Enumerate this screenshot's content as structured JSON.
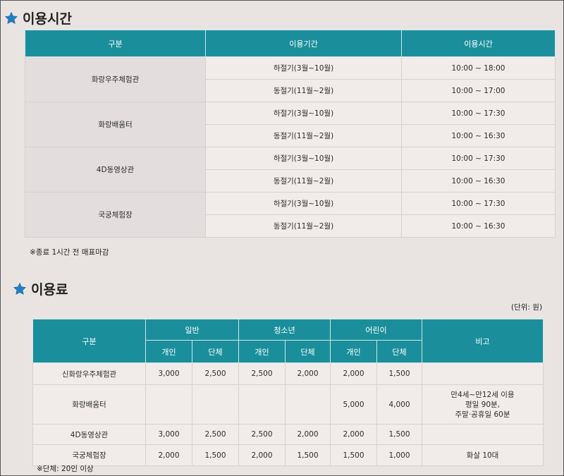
{
  "hours_section": {
    "title": "이용시간",
    "headers": [
      "구분",
      "이용기간",
      "이용시간"
    ],
    "rows": [
      {
        "facility": "화랑우주체험관",
        "periods": [
          {
            "period": "하절기(3월~10월)",
            "time": "10:00 ~ 18:00"
          },
          {
            "period": "동절기(11월~2월)",
            "time": "10:00 ~ 17:00"
          }
        ]
      },
      {
        "facility": "화랑배움터",
        "periods": [
          {
            "period": "하절기(3월~10월)",
            "time": "10:00 ~ 17:30"
          },
          {
            "period": "동절기(11월~2월)",
            "time": "10:00 ~ 16:30"
          }
        ]
      },
      {
        "facility": "4D동영상관",
        "periods": [
          {
            "period": "하절기(3월~10월)",
            "time": "10:00 ~ 17:30"
          },
          {
            "period": "동절기(11월~2월)",
            "time": "10:00 ~ 16:30"
          }
        ]
      },
      {
        "facility": "국궁체험장",
        "periods": [
          {
            "period": "하절기(3월~10월)",
            "time": "10:00 ~ 17:30"
          },
          {
            "period": "동절기(11월~2월)",
            "time": "10:00 ~ 16:30"
          }
        ]
      }
    ],
    "note": "※종료 1시간 전 매표마감"
  },
  "fees_section": {
    "title": "이용료",
    "unit": "(단위: 원)",
    "header_category": "구분",
    "groups": [
      "일반",
      "청소년",
      "어린이"
    ],
    "sub_headers": [
      "개인",
      "단체"
    ],
    "header_remark": "비고",
    "rows": [
      {
        "facility": "신화랑우주체험관",
        "values": [
          "3,000",
          "2,500",
          "2,500",
          "2,000",
          "2,000",
          "1,500"
        ],
        "remark": []
      },
      {
        "facility": "화랑배움터",
        "values": [
          "",
          "",
          "",
          "",
          "5,000",
          "4,000"
        ],
        "remark": [
          "만4세~만12세 이용",
          "평일 90분,",
          "주말·공휴일 60분"
        ]
      },
      {
        "facility": "4D동영상관",
        "values": [
          "3,000",
          "2,500",
          "2,500",
          "2,000",
          "2,000",
          "1,500"
        ],
        "remark": []
      },
      {
        "facility": "국궁체험장",
        "values": [
          "2,000",
          "1,500",
          "2,000",
          "1,500",
          "1,500",
          "1,000"
        ],
        "remark": [
          "화살 10대"
        ]
      }
    ],
    "note": "※단체: 20인 이상"
  },
  "colors": {
    "header_teal": "#1a8f9b",
    "star_blue": "#1f7fc4",
    "page_bg": "#e9e4e2"
  }
}
